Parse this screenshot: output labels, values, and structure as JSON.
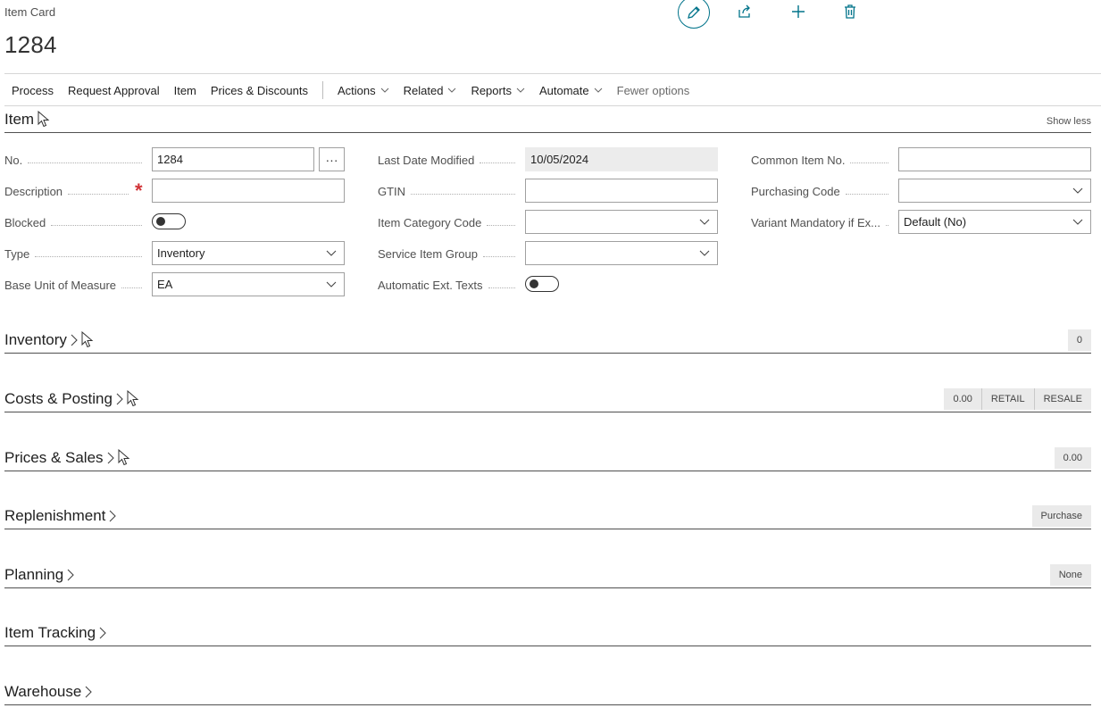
{
  "header": {
    "caption": "Item Card",
    "title": "1284",
    "icons": [
      "edit-icon",
      "share-icon",
      "plus-icon",
      "delete-icon"
    ]
  },
  "actionbar": {
    "items": [
      "Process",
      "Request Approval",
      "Item",
      "Prices & Discounts"
    ],
    "menus": [
      "Actions",
      "Related",
      "Reports",
      "Automate"
    ],
    "fewer": "Fewer options"
  },
  "item_section": {
    "title": "Item",
    "show_less": "Show less",
    "col1": {
      "no_label": "No.",
      "no_value": "1284",
      "no_lookup": "···",
      "description_label": "Description",
      "description_value": "",
      "blocked_label": "Blocked",
      "blocked_value": "off",
      "type_label": "Type",
      "type_value": "Inventory",
      "uom_label": "Base Unit of Measure",
      "uom_value": "EA"
    },
    "col2": {
      "last_modified_label": "Last Date Modified",
      "last_modified_value": "10/05/2024",
      "gtin_label": "GTIN",
      "gtin_value": "",
      "category_label": "Item Category Code",
      "category_value": "",
      "service_label": "Service Item Group",
      "service_value": "",
      "ext_texts_label": "Automatic Ext. Texts",
      "ext_texts_value": "off"
    },
    "col3": {
      "common_label": "Common Item No.",
      "common_value": "",
      "purchasing_label": "Purchasing Code",
      "purchasing_value": "",
      "variant_label": "Variant Mandatory if Ex...",
      "variant_value": "Default (No)"
    }
  },
  "sections": {
    "inventory": {
      "title": "Inventory",
      "badges": [
        "0"
      ]
    },
    "costs": {
      "title": "Costs & Posting",
      "badges": [
        "0.00",
        "RETAIL",
        "RESALE"
      ]
    },
    "prices": {
      "title": "Prices & Sales",
      "badges": [
        "0.00"
      ]
    },
    "replenishment": {
      "title": "Replenishment",
      "badges": [
        "Purchase"
      ]
    },
    "planning": {
      "title": "Planning",
      "badges": [
        "None"
      ]
    },
    "tracking": {
      "title": "Item Tracking"
    },
    "warehouse": {
      "title": "Warehouse"
    }
  },
  "colors": {
    "accent": "#00738a",
    "required": "#d13438"
  }
}
